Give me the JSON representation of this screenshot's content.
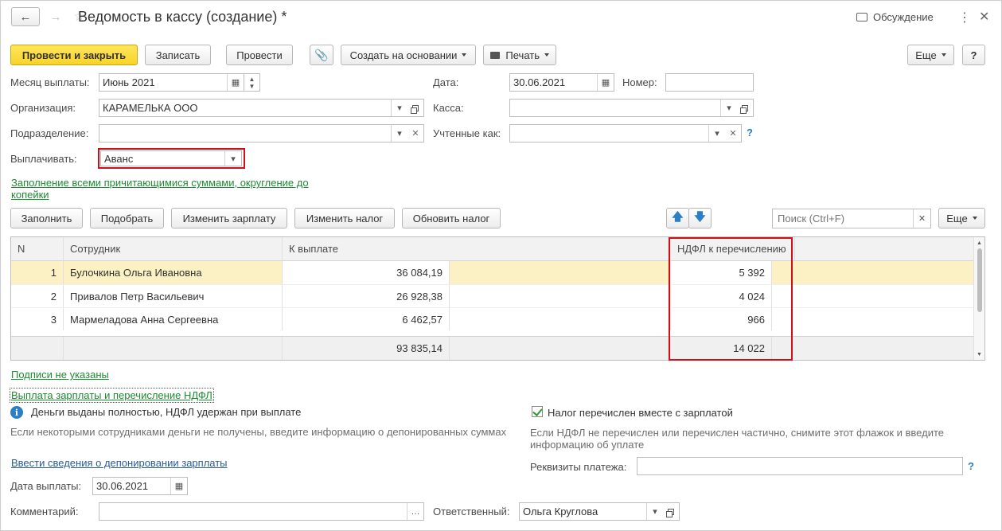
{
  "window": {
    "title": "Ведомость в кассу (создание) *",
    "discussion": "Обсуждение"
  },
  "toolbar": {
    "post_close": "Провести и закрыть",
    "write": "Записать",
    "post": "Провести",
    "create_based": "Создать на основании",
    "print": "Печать",
    "more": "Еще",
    "help": "?"
  },
  "form": {
    "month_label": "Месяц выплаты:",
    "month_value": "Июнь 2021",
    "date_label": "Дата:",
    "date_value": "30.06.2021",
    "number_label": "Номер:",
    "number_value": "",
    "org_label": "Организация:",
    "org_value": "КАРАМЕЛЬКА ООО",
    "kassa_label": "Касса:",
    "kassa_value": "",
    "dept_label": "Подразделение:",
    "dept_value": "",
    "accounted_label": "Учтенные как:",
    "accounted_value": "",
    "pay_label": "Выплачивать:",
    "pay_value": "Аванс",
    "fill_link": "Заполнение всеми причитающимися суммами, округление до копейки"
  },
  "table_toolbar": {
    "fill": "Заполнить",
    "pick": "Подобрать",
    "change_salary": "Изменить зарплату",
    "change_tax": "Изменить налог",
    "update_tax": "Обновить налог",
    "search_placeholder": "Поиск (Ctrl+F)",
    "more": "Еще"
  },
  "table": {
    "headers": {
      "n": "N",
      "employee": "Сотрудник",
      "to_pay": "К выплате",
      "ndfl": "НДФЛ к перечислению"
    },
    "rows": [
      {
        "n": "1",
        "employee": "Булочкина Ольга Ивановна",
        "to_pay": "36 084,19",
        "ndfl": "5 392"
      },
      {
        "n": "2",
        "employee": "Привалов Петр Васильевич",
        "to_pay": "26 928,38",
        "ndfl": "4 024"
      },
      {
        "n": "3",
        "employee": "Мармеладова Анна Сергеевна",
        "to_pay": "6 462,57",
        "ndfl": "966"
      }
    ],
    "totals": {
      "to_pay": "93 835,14",
      "ndfl": "14 022"
    }
  },
  "bottom": {
    "signatures_link": "Подписи не указаны",
    "payment_link": "Выплата зарплаты и перечисление НДФЛ",
    "paid_info": "Деньги выданы полностью, НДФЛ удержан при выплате",
    "paid_hint": "Если некоторыми сотрудниками деньги не получены, введите информацию о депонированных суммах",
    "deposit_link": "Ввести сведения о депонировании зарплаты",
    "tax_checkbox": "Налог перечислен вместе с зарплатой",
    "tax_hint": "Если НДФЛ не перечислен или перечислен частично, снимите этот флажок и введите информацию об уплате",
    "payment_details_label": "Реквизиты платежа:",
    "payment_details_value": "",
    "pay_date_label": "Дата выплаты:",
    "pay_date_value": "30.06.2021",
    "comment_label": "Комментарий:",
    "comment_value": "",
    "responsible_label": "Ответственный:",
    "responsible_value": "Ольга Круглова"
  }
}
